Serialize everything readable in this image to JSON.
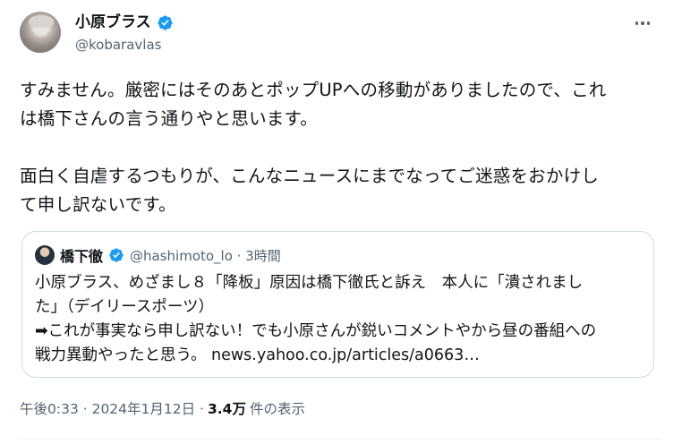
{
  "author": {
    "display_name": "小原ブラス",
    "handle": "@kobaravlas",
    "verified_icon": "verified-badge-icon"
  },
  "tweet": {
    "text": "すみません。厳密にはそのあとポップUPへの移動がありましたので、これ\nは橋下さんの言う通りやと思います。\n\n面白く自虐するつもりが、こんなニュースにまでなってご迷惑をおかけし\nて申し訳ないです。"
  },
  "quoted": {
    "display_name": "橋下徹",
    "handle_time": "@hashimoto_lo · 3時間",
    "text": "小原ブラス、めざまし８「降板」原因は橋下徹氏と訴え　本人に「潰されまし\nた」（デイリースポーツ）\n➡これが事実なら申し訳ない！でも小原さんが鋭いコメントやから昼の番組への\n戦力異動やったと思う。 news.yahoo.co.jp/articles/a0663…"
  },
  "meta": {
    "timestamp": "午後0:33 · 2024年1月12日 · ",
    "views_count": "3.4万",
    "views_label": "件の表示"
  },
  "colors": {
    "verified": "#1d9bf0",
    "secondary_text": "#536471",
    "primary_text": "#0f1419",
    "border": "#cfd9de"
  },
  "icons": {
    "more": "more-options-icon"
  }
}
